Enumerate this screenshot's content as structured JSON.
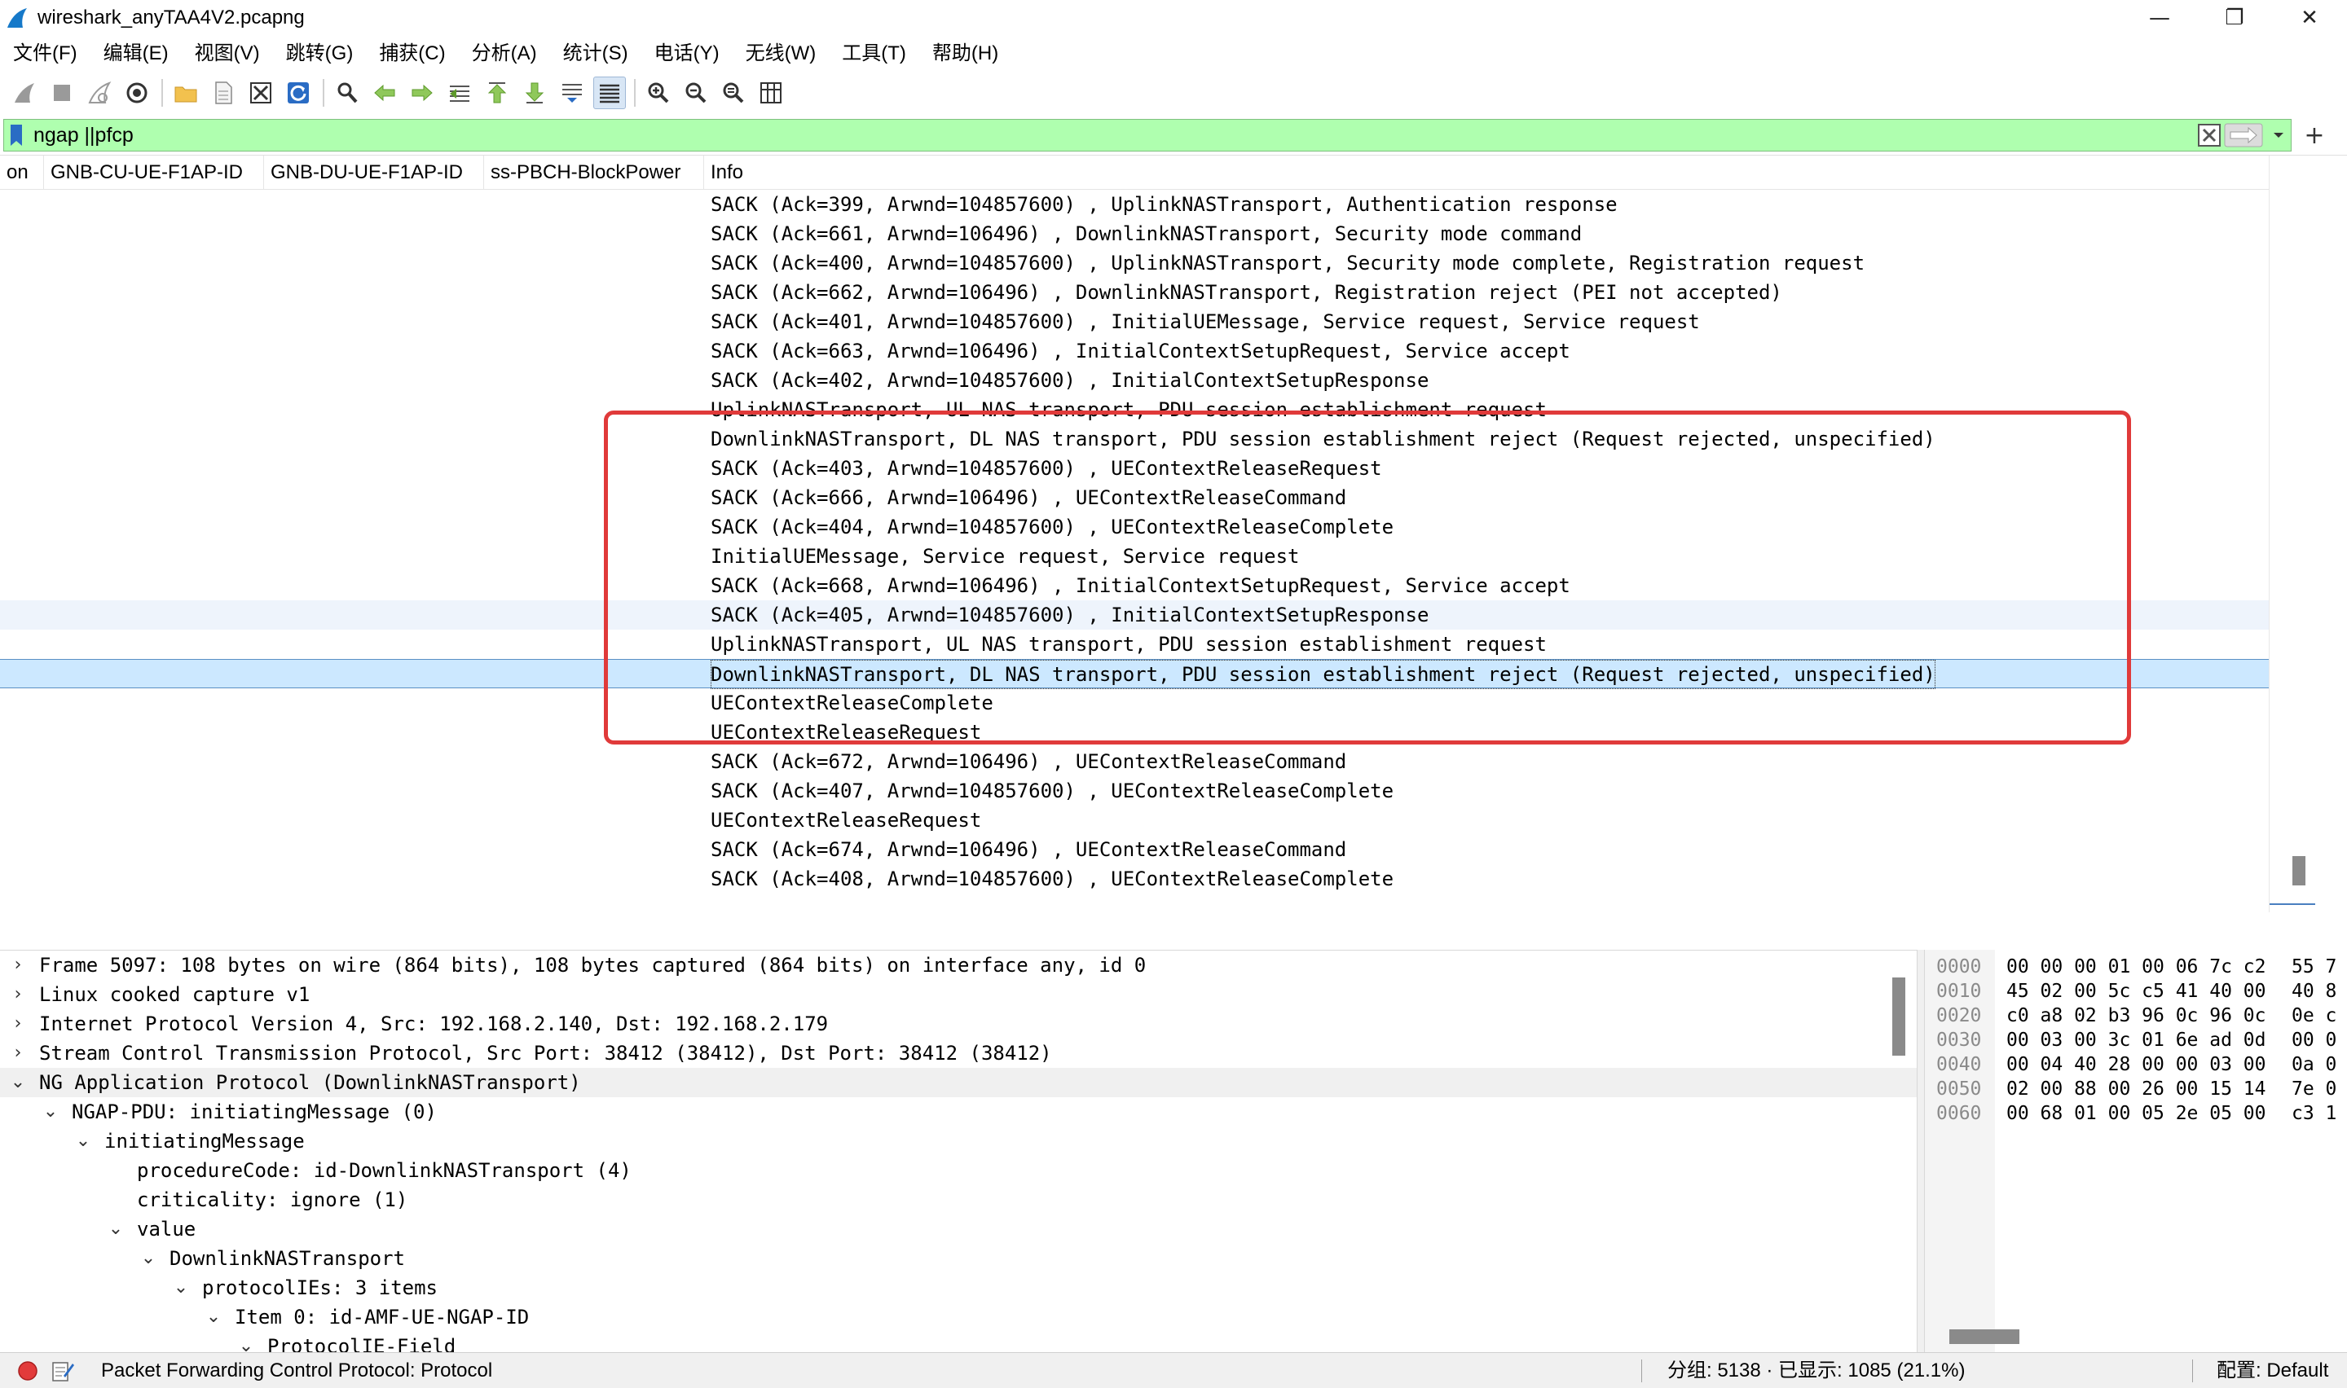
{
  "window": {
    "title": "wireshark_anyTAA4V2.pcapng",
    "minimize": "—",
    "restore": "❐",
    "close": "✕"
  },
  "menu": [
    "文件(F)",
    "编辑(E)",
    "视图(V)",
    "跳转(G)",
    "捕获(C)",
    "分析(A)",
    "统计(S)",
    "电话(Y)",
    "无线(W)",
    "工具(T)",
    "帮助(H)"
  ],
  "filter": {
    "value": "ngap ||pfcp",
    "plus": "+"
  },
  "packet_list": {
    "columns": [
      "on",
      "GNB-CU-UE-F1AP-ID",
      "GNB-DU-UE-F1AP-ID",
      "ss-PBCH-BlockPower",
      "Info"
    ],
    "rows": [
      "SACK (Ack=399, Arwnd=104857600) , UplinkNASTransport, Authentication response",
      "SACK (Ack=661, Arwnd=106496) , DownlinkNASTransport, Security mode command",
      "SACK (Ack=400, Arwnd=104857600) , UplinkNASTransport, Security mode complete, Registration request",
      "SACK (Ack=662, Arwnd=106496) , DownlinkNASTransport, Registration reject (PEI not accepted)",
      "SACK (Ack=401, Arwnd=104857600) , InitialUEMessage, Service request, Service request",
      "SACK (Ack=663, Arwnd=106496) , InitialContextSetupRequest, Service accept",
      "SACK (Ack=402, Arwnd=104857600) , InitialContextSetupResponse",
      "UplinkNASTransport, UL NAS transport, PDU session establishment request",
      "DownlinkNASTransport, DL NAS transport, PDU session establishment reject (Request rejected, unspecified)",
      "SACK (Ack=403, Arwnd=104857600) , UEContextReleaseRequest",
      "SACK (Ack=666, Arwnd=106496) , UEContextReleaseCommand",
      "SACK (Ack=404, Arwnd=104857600) , UEContextReleaseComplete",
      "InitialUEMessage, Service request, Service request",
      "SACK (Ack=668, Arwnd=106496) , InitialContextSetupRequest, Service accept",
      "SACK (Ack=405, Arwnd=104857600) , InitialContextSetupResponse",
      "UplinkNASTransport, UL NAS transport, PDU session establishment request",
      "DownlinkNASTransport, DL NAS transport, PDU session establishment reject (Request rejected, unspecified)",
      "UEContextReleaseComplete",
      "UEContextReleaseRequest",
      "SACK (Ack=672, Arwnd=106496) , UEContextReleaseCommand",
      "SACK (Ack=407, Arwnd=104857600) , UEContextReleaseComplete",
      "UEContextReleaseRequest",
      "SACK (Ack=674, Arwnd=106496) , UEContextReleaseCommand",
      "SACK (Ack=408, Arwnd=104857600) , UEContextReleaseComplete"
    ],
    "hover_row": 14,
    "selected_row": 16,
    "highlight_color": "#e03a3a"
  },
  "details": [
    {
      "arrow": "›",
      "level": 0,
      "text": "Frame 5097: 108 bytes on wire (864 bits), 108 bytes captured (864 bits) on interface any, id 0"
    },
    {
      "arrow": "›",
      "level": 0,
      "text": "Linux cooked capture v1"
    },
    {
      "arrow": "›",
      "level": 0,
      "text": "Internet Protocol Version 4, Src: 192.168.2.140, Dst: 192.168.2.179"
    },
    {
      "arrow": "›",
      "level": 0,
      "text": "Stream Control Transmission Protocol, Src Port: 38412 (38412), Dst Port: 38412 (38412)"
    },
    {
      "arrow": "⌄",
      "level": 0,
      "text": "NG Application Protocol (DownlinkNASTransport)",
      "selected": true
    },
    {
      "arrow": "⌄",
      "level": 1,
      "text": "NGAP-PDU: initiatingMessage (0)"
    },
    {
      "arrow": "⌄",
      "level": 2,
      "text": "initiatingMessage"
    },
    {
      "arrow": "",
      "level": 3,
      "text": "procedureCode: id-DownlinkNASTransport (4)"
    },
    {
      "arrow": "",
      "level": 3,
      "text": "criticality: ignore (1)"
    },
    {
      "arrow": "⌄",
      "level": 3,
      "text": "value"
    },
    {
      "arrow": "⌄",
      "level": 4,
      "text": "DownlinkNASTransport"
    },
    {
      "arrow": "⌄",
      "level": 5,
      "text": "protocolIEs: 3 items"
    },
    {
      "arrow": "⌄",
      "level": 6,
      "text": "Item 0: id-AMF-UE-NGAP-ID"
    },
    {
      "arrow": "⌄",
      "level": 7,
      "text": "ProtocolIE-Field"
    }
  ],
  "bytes": [
    {
      "off": "0000",
      "hex": "00 00 00 01 00 06 7c c2",
      "hex2": "55 7"
    },
    {
      "off": "0010",
      "hex": "45 02 00 5c c5 41 40 00",
      "hex2": "40 8"
    },
    {
      "off": "0020",
      "hex": "c0 a8 02 b3 96 0c 96 0c",
      "hex2": "0e c"
    },
    {
      "off": "0030",
      "hex": "00 03 00 3c 01 6e ad 0d",
      "hex2": "00 0"
    },
    {
      "off": "0040",
      "hex": "00 04 40 28 00 00 03 00",
      "hex2": "0a 0"
    },
    {
      "off": "0050",
      "hex": "02 00 88 00 26 00 15 14",
      "hex2": "7e 0"
    },
    {
      "off": "0060",
      "hex": "00 68 01 00 05 2e 05 00",
      "hex2": "c3 1"
    }
  ],
  "status": {
    "protocol_text": "Packet Forwarding Control Protocol: Protocol",
    "packets_text": "分组: 5138 · 已显示: 1085 (21.1%)",
    "profile_text": "配置: Default"
  }
}
